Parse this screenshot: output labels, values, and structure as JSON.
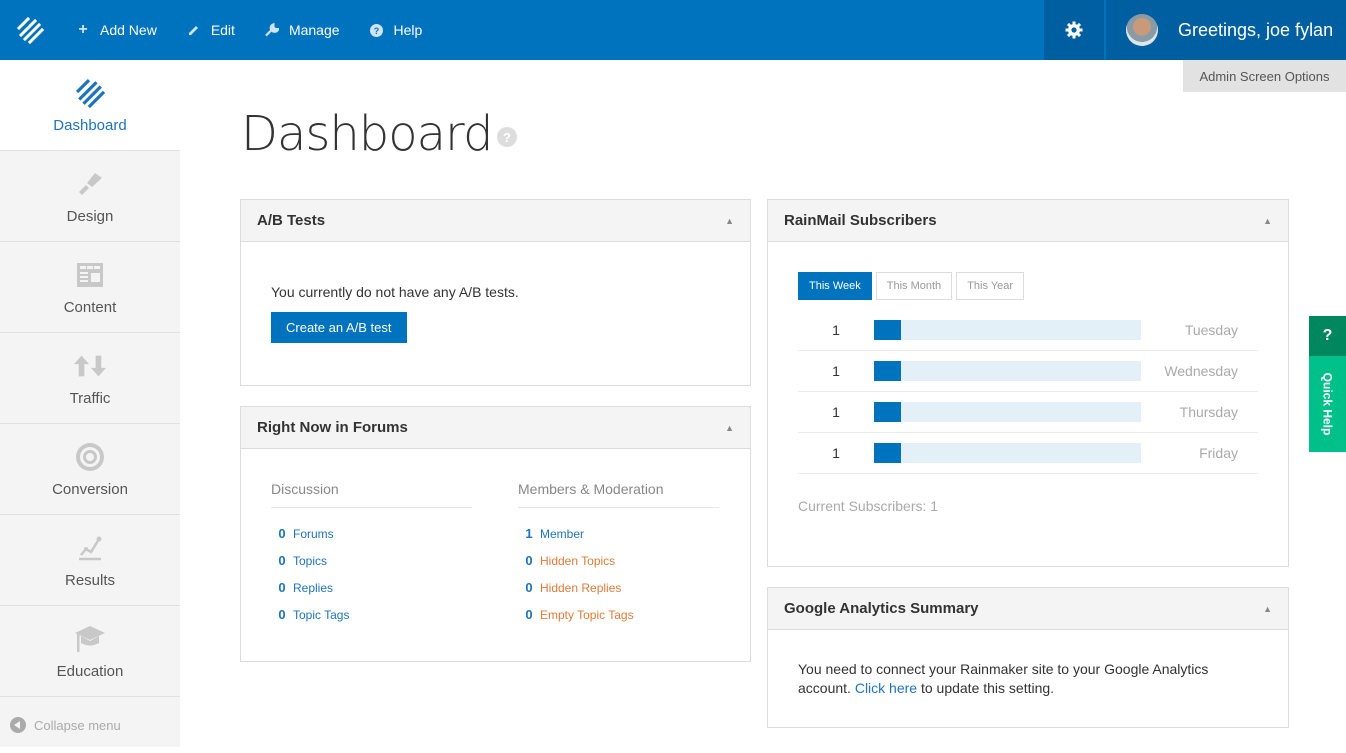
{
  "topbar": {
    "logo": "rainmaker-logo-icon",
    "nav": [
      {
        "label": "Add New",
        "icon": "plus-icon"
      },
      {
        "label": "Edit",
        "icon": "pencil-icon"
      },
      {
        "label": "Manage",
        "icon": "wrench-icon"
      },
      {
        "label": "Help",
        "icon": "question-circle-icon"
      }
    ],
    "settings_icon": "gear-icon",
    "greeting": "Greetings, joe fylan",
    "screen_options": "Admin Screen Options"
  },
  "sidebar": {
    "items": [
      {
        "label": "Dashboard",
        "icon": "rainmaker-logo-icon",
        "active": true
      },
      {
        "label": "Design",
        "icon": "paintbrush-icon"
      },
      {
        "label": "Content",
        "icon": "layout-icon"
      },
      {
        "label": "Traffic",
        "icon": "up-down-arrows-icon"
      },
      {
        "label": "Conversion",
        "icon": "target-icon"
      },
      {
        "label": "Results",
        "icon": "line-chart-icon"
      },
      {
        "label": "Education",
        "icon": "graduation-cap-icon"
      }
    ],
    "collapse_label": "Collapse menu"
  },
  "page": {
    "title": "Dashboard",
    "help_glyph": "?"
  },
  "ab_tests": {
    "title": "A/B Tests",
    "message": "You currently do not have any A/B tests.",
    "button": "Create an A/B test"
  },
  "forums": {
    "title": "Right Now in Forums",
    "discussion": {
      "heading": "Discussion",
      "rows": [
        {
          "count": "0",
          "label": "Forums"
        },
        {
          "count": "0",
          "label": "Topics"
        },
        {
          "count": "0",
          "label": "Replies"
        },
        {
          "count": "0",
          "label": "Topic Tags"
        }
      ]
    },
    "members": {
      "heading": "Members & Moderation",
      "rows": [
        {
          "count": "1",
          "label": "Member",
          "warn": false
        },
        {
          "count": "0",
          "label": "Hidden Topics",
          "warn": true
        },
        {
          "count": "0",
          "label": "Hidden Replies",
          "warn": true
        },
        {
          "count": "0",
          "label": "Empty Topic Tags",
          "warn": true
        }
      ]
    }
  },
  "rainmail": {
    "title": "RainMail Subscribers",
    "tabs": [
      {
        "label": "This Week",
        "active": true
      },
      {
        "label": "This Month",
        "active": false
      },
      {
        "label": "This Year",
        "active": false
      }
    ],
    "rows": [
      {
        "count": "1",
        "day": "Tuesday",
        "fill_fraction": 0.1
      },
      {
        "count": "1",
        "day": "Wednesday",
        "fill_fraction": 0.1
      },
      {
        "count": "1",
        "day": "Thursday",
        "fill_fraction": 0.1
      },
      {
        "count": "1",
        "day": "Friday",
        "fill_fraction": 0.1
      }
    ],
    "current": "Current Subscribers: 1"
  },
  "google_analytics": {
    "title": "Google Analytics Summary",
    "text_before": "You need to connect your Rainmaker site to your Google Analytics account. ",
    "link": "Click here",
    "text_after": " to update this setting."
  },
  "quick_help": {
    "glyph": "?",
    "label": "Quick Help"
  },
  "colors": {
    "brand_blue": "#0073bf",
    "dark_blue": "#005fa0",
    "link_blue": "#1e73be",
    "warn_orange": "#e07b39",
    "quick_help_green": "#00c08a",
    "quick_help_dark_green": "#00875e",
    "bar_track": "#e4f0f8"
  }
}
